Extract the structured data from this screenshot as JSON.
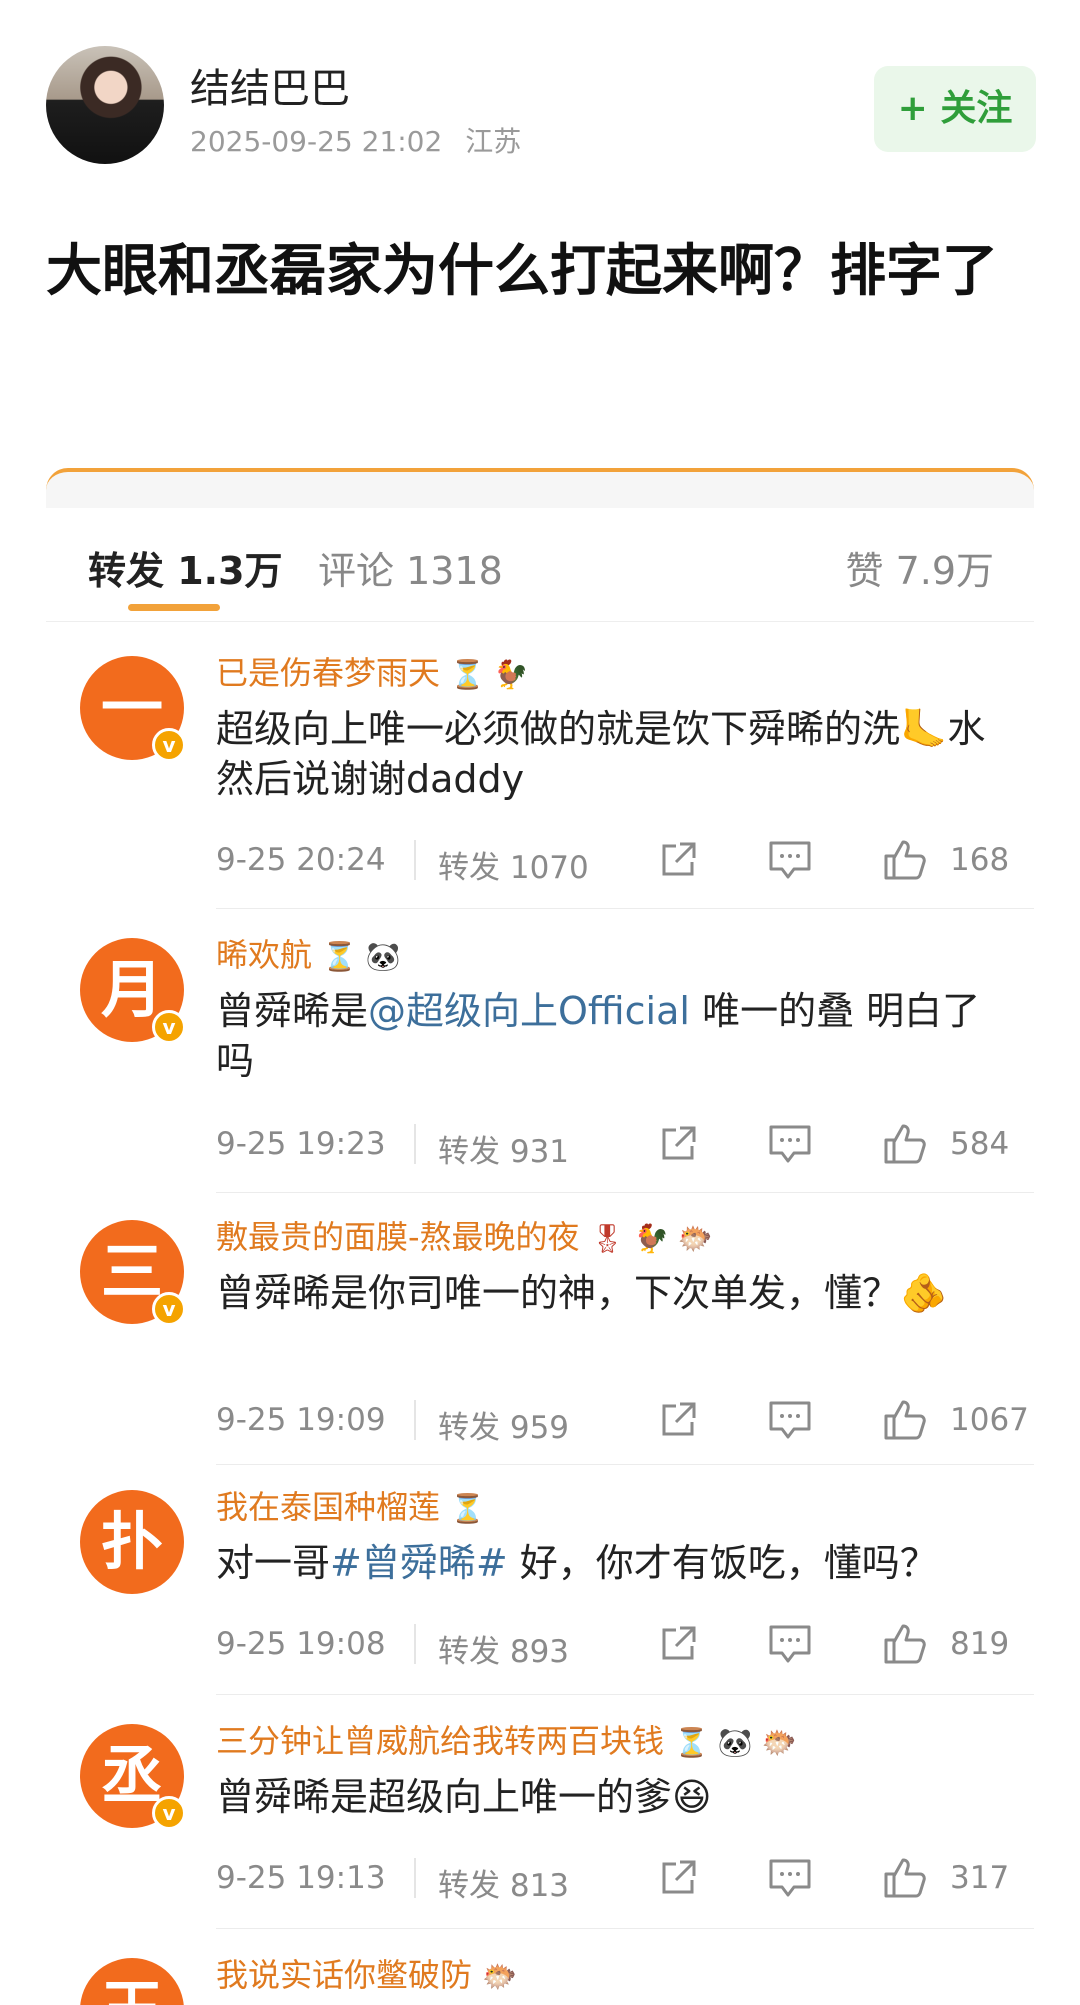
{
  "post": {
    "author": "结结巴巴",
    "datetime": "2025-09-25 21:02",
    "location": "江苏",
    "follow_label": "+ 关注",
    "title": "大眼和丞磊家为什么打起来啊？排字了"
  },
  "tabs": {
    "repost": "转发 1.3万",
    "comment": "评论 1318",
    "like": "赞 7.9万"
  },
  "colors": {
    "accent": "#f2a23a",
    "name": "#e07a1f",
    "follow_bg": "#eaf7ea",
    "follow_text": "#2f9e3a",
    "mention": "#3d6f9b",
    "avatar_orange": "#f26b1d"
  },
  "comments": [
    {
      "avatar_char": "一",
      "name": "已是伤春梦雨天",
      "badges": "⏳ 🐓",
      "text_parts": [
        "超级向上唯一必须做的就是饮下舜晞的洗🦶水然后说谢谢daddy"
      ],
      "time": "9-25 20:24",
      "repost": "转发 1070",
      "likes": "168"
    },
    {
      "avatar_char": "月",
      "name": "晞欢航",
      "badges": "⏳ 🐼",
      "text_before": "曾舜晞是",
      "mention": "@超级向上Official",
      "text_after": "唯一的叠 明白了吗",
      "time": "9-25 19:23",
      "repost": "转发 931",
      "likes": "584"
    },
    {
      "avatar_char": "三",
      "name": "敷最贵的面膜-熬最晚的夜",
      "badges": "🎖 🐓 🐡",
      "text_parts": [
        "曾舜晞是你司唯一的神，下次单发，懂？🫵"
      ],
      "time": "9-25 19:09",
      "repost": "转发 959",
      "likes": "1067"
    },
    {
      "avatar_char": "扑",
      "name": "我在泰国种榴莲",
      "badges": "⏳",
      "text_before": "对一哥",
      "mention": "#曾舜晞#",
      "text_after": " 好，你才有饭吃，懂吗？",
      "time": "9-25 19:08",
      "repost": "转发 893",
      "likes": "819"
    },
    {
      "avatar_char": "丞",
      "name": "三分钟让曾威航给我转两百块钱",
      "badges": "⏳ 🐼 🐡",
      "text_parts": [
        "曾舜晞是超级向上唯一的爹😆"
      ],
      "time": "9-25 19:13",
      "repost": "转发 813",
      "likes": "317"
    },
    {
      "avatar_char": "玉",
      "name": "我说实话你鳖破防",
      "badges": "🐡"
    }
  ]
}
